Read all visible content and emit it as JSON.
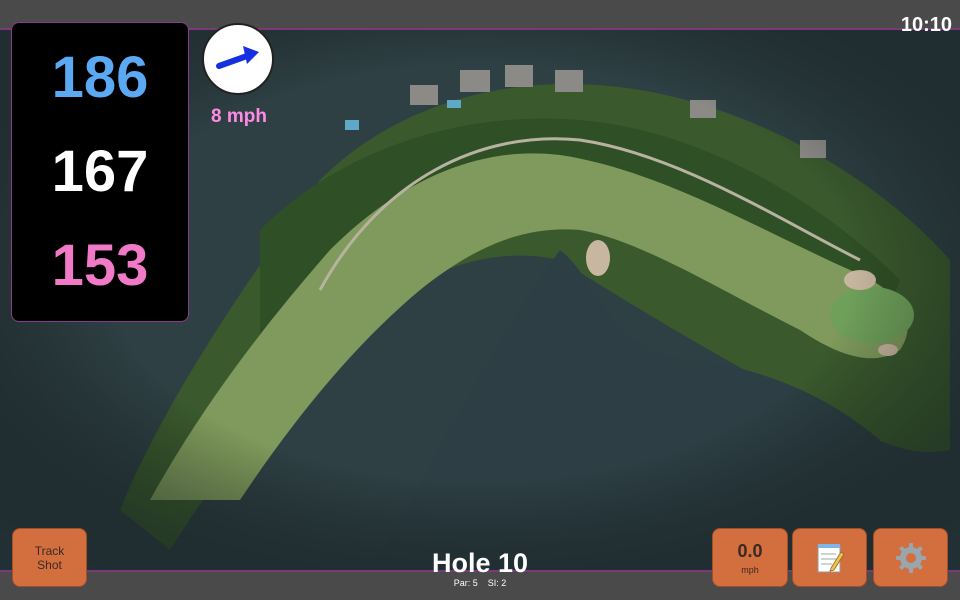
{
  "status": {
    "time": "10:10"
  },
  "distances": {
    "back": "186",
    "middle": "167",
    "front": "153"
  },
  "wind": {
    "speed_label": "8 mph",
    "icon": "wind-direction-arrow-icon"
  },
  "hole": {
    "title": "Hole 10",
    "par_label": "Par: 5",
    "si_label": "SI: 2"
  },
  "buttons": {
    "track_shot_line1": "Track",
    "track_shot_line2": "Shot",
    "speed_value": "0.0",
    "speed_unit": "mph",
    "notes_icon": "notepad-icon",
    "settings_icon": "gear-icon"
  },
  "colors": {
    "back_distance": "#5aa9f2",
    "middle_distance": "#ffffff",
    "front_distance": "#f07ac8",
    "wind_text": "#ff8be6",
    "button": "#d36f3f",
    "arrow": "#1530e0"
  }
}
